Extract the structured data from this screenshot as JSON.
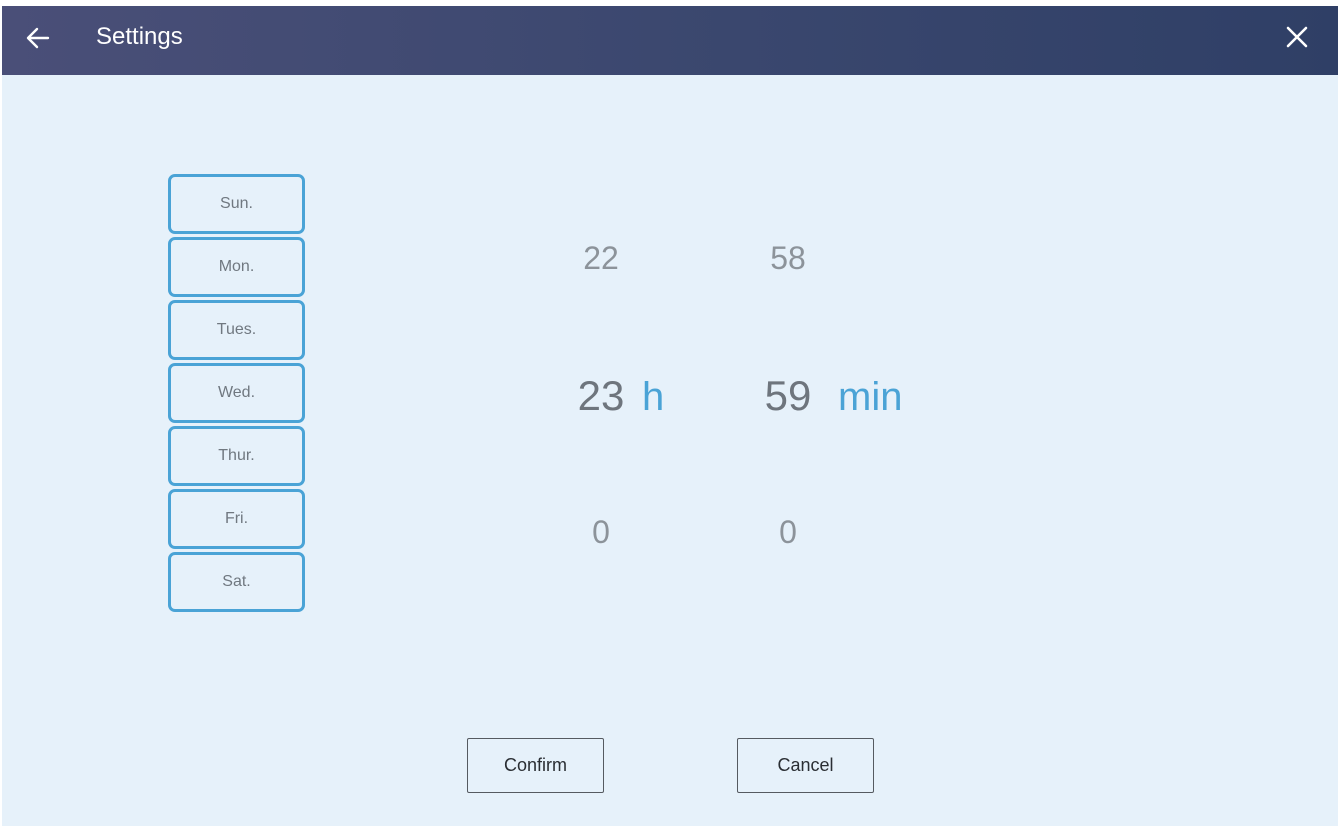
{
  "header": {
    "title": "Settings",
    "back_icon": "arrow-left-icon",
    "close_icon": "close-icon"
  },
  "days": [
    "Sun.",
    "Mon.",
    "Tues.",
    "Wed.",
    "Thur.",
    "Fri.",
    "Sat."
  ],
  "hours": {
    "prev": "22",
    "selected": "23",
    "next": "0",
    "unit": "h"
  },
  "minutes": {
    "prev": "58",
    "selected": "59",
    "next": "0",
    "unit": "min"
  },
  "actions": {
    "confirm": "Confirm",
    "cancel": "Cancel"
  },
  "colors": {
    "header_start": "#4a4f78",
    "header_end": "#2f3f66",
    "background": "#e6f1fa",
    "accent": "#4aa3d6"
  }
}
